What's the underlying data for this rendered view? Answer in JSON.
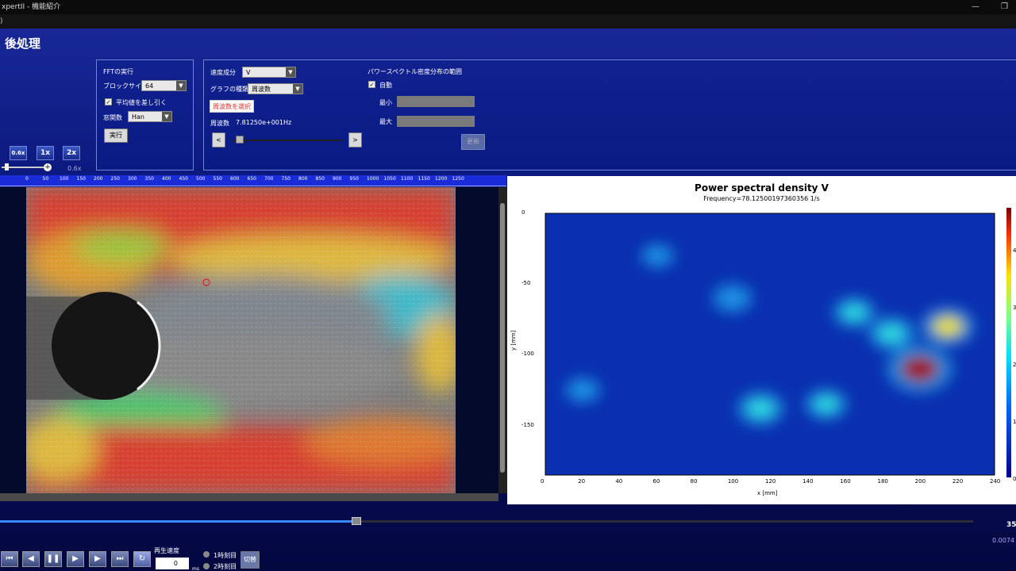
{
  "window": {
    "title": "xpertII - 機能紹介",
    "menu_fragment": ")"
  },
  "page_title": "後処理",
  "zoom": {
    "btn_small": "0.6x",
    "btn_1": "1x",
    "btn_2": "2x",
    "level": "0.6x"
  },
  "fft": {
    "header": "FFTの実行",
    "block_size_label": "ブロックサイズ",
    "block_size_value": "64",
    "subtract_mean_label": "平均値を差し引く",
    "subtract_mean_checked": "✓",
    "window_label": "窓関数",
    "window_value": "Han",
    "run_button": "実行"
  },
  "spectrum": {
    "velocity_label": "速度成分",
    "velocity_value": "V",
    "graph_type_label": "グラフの種類",
    "graph_type_value": "周波数",
    "select_freq_button": "周波数を選択",
    "freq_label": "周波数",
    "freq_value": "7.81250e+001Hz",
    "prev_button": "<",
    "next_button": ">",
    "range_header": "パワースペクトル密度分布の範囲",
    "auto_label": "自動",
    "auto_checked": "✓",
    "min_label": "最小",
    "max_label": "最大",
    "update_button": "更新"
  },
  "ruler": [
    "0",
    "50",
    "100",
    "150",
    "200",
    "250",
    "300",
    "350",
    "400",
    "450",
    "500",
    "550",
    "600",
    "650",
    "700",
    "750",
    "800",
    "850",
    "900",
    "950",
    "1000",
    "1050",
    "1100",
    "1150",
    "1200",
    "1250"
  ],
  "chart_data": {
    "type": "heatmap",
    "title": "Power spectral density V",
    "subtitle": "Frequency=78.12500197360356 1/s",
    "xlabel": "x [mm]",
    "ylabel": "y [mm]",
    "x_ticks": [
      "0",
      "20",
      "40",
      "60",
      "80",
      "100",
      "120",
      "140",
      "160",
      "180",
      "200",
      "220",
      "240"
    ],
    "y_ticks": [
      "0",
      "-50",
      "-100",
      "-150"
    ],
    "xlim": [
      0,
      240
    ],
    "ylim": [
      -185,
      0
    ],
    "colorbar_ticks": [
      "4",
      "3",
      "2",
      "1",
      "0"
    ],
    "hotspots": [
      {
        "x": 200,
        "y": -110,
        "intensity": 1.0
      },
      {
        "x": 215,
        "y": -80,
        "intensity": 0.7
      },
      {
        "x": 185,
        "y": -85,
        "intensity": 0.55
      },
      {
        "x": 115,
        "y": -138,
        "intensity": 0.55
      },
      {
        "x": 150,
        "y": -135,
        "intensity": 0.45
      },
      {
        "x": 100,
        "y": -60,
        "intensity": 0.4
      },
      {
        "x": 165,
        "y": -70,
        "intensity": 0.45
      },
      {
        "x": 60,
        "y": -30,
        "intensity": 0.25
      },
      {
        "x": 20,
        "y": -125,
        "intensity": 0.3
      }
    ]
  },
  "playback": {
    "speed_label": "再生速度",
    "speed_value": "0",
    "speed_unit": "ms",
    "time1_label": "1時刻目",
    "time2_label": "2時刻目",
    "switch_button": "切替",
    "frame_number": "35",
    "time_value": "0.0074",
    "progress": 0.366
  }
}
